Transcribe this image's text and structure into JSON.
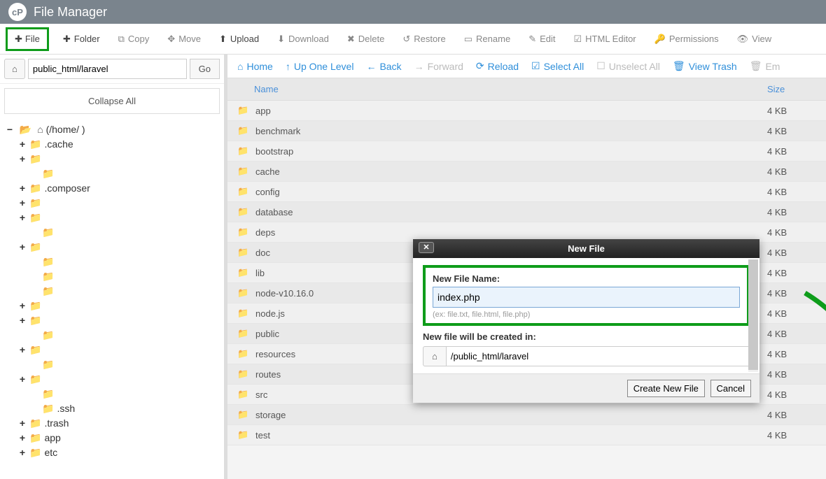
{
  "header": {
    "title": "File Manager"
  },
  "toolbar": {
    "file": "File",
    "folder": "Folder",
    "copy": "Copy",
    "move": "Move",
    "upload": "Upload",
    "download": "Download",
    "delete": "Delete",
    "restore": "Restore",
    "rename": "Rename",
    "edit": "Edit",
    "html_editor": "HTML Editor",
    "permissions": "Permissions",
    "view": "View"
  },
  "path": {
    "value": "public_html/laravel",
    "go": "Go"
  },
  "collapse": "Collapse All",
  "tree": {
    "root": "(/home/         )",
    "items": [
      {
        "exp": "+",
        "label": ".cache",
        "i": 1
      },
      {
        "exp": "+",
        "label": "      ",
        "i": 1
      },
      {
        "exp": "",
        "label": "           ",
        "i": 2
      },
      {
        "exp": "+",
        "label": ".composer",
        "i": 1
      },
      {
        "exp": "+",
        "label": "       ",
        "i": 1
      },
      {
        "exp": "+",
        "label": "        ",
        "i": 1
      },
      {
        "exp": "",
        "label": "        ",
        "i": 2
      },
      {
        "exp": "+",
        "label": "    ",
        "i": 1
      },
      {
        "exp": "",
        "label": "        ",
        "i": 2
      },
      {
        "exp": "",
        "label": "           ",
        "i": 2
      },
      {
        "exp": "",
        "label": "         ",
        "i": 2
      },
      {
        "exp": "+",
        "label": "    ",
        "i": 1
      },
      {
        "exp": "+",
        "label": "    ",
        "i": 1
      },
      {
        "exp": "",
        "label": "   ",
        "i": 2
      },
      {
        "exp": "+",
        "label": "  ",
        "i": 1
      },
      {
        "exp": "",
        "label": "   ",
        "i": 2
      },
      {
        "exp": "+",
        "label": "          ",
        "i": 1
      },
      {
        "exp": "",
        "label": "             ",
        "i": 2
      },
      {
        "exp": "",
        "label": ".ssh",
        "i": 2
      },
      {
        "exp": "+",
        "label": ".trash",
        "i": 1
      },
      {
        "exp": "+",
        "label": "app",
        "i": 1
      },
      {
        "exp": "+",
        "label": "etc",
        "i": 1
      }
    ]
  },
  "actions": {
    "home": "Home",
    "up": "Up One Level",
    "back": "Back",
    "forward": "Forward",
    "reload": "Reload",
    "select_all": "Select All",
    "unselect_all": "Unselect All",
    "view_trash": "View Trash",
    "empty": "Em"
  },
  "table": {
    "name": "Name",
    "size": "Size"
  },
  "files": [
    {
      "name": "app",
      "size": "4 KB"
    },
    {
      "name": "benchmark",
      "size": "4 KB"
    },
    {
      "name": "bootstrap",
      "size": "4 KB"
    },
    {
      "name": "cache",
      "size": "4 KB"
    },
    {
      "name": "config",
      "size": "4 KB"
    },
    {
      "name": "database",
      "size": "4 KB"
    },
    {
      "name": "deps",
      "size": "4 KB"
    },
    {
      "name": "doc",
      "size": "4 KB"
    },
    {
      "name": "lib",
      "size": "4 KB"
    },
    {
      "name": "node-v10.16.0",
      "size": "4 KB"
    },
    {
      "name": "node.js",
      "size": "4 KB"
    },
    {
      "name": "public",
      "size": "4 KB"
    },
    {
      "name": "resources",
      "size": "4 KB"
    },
    {
      "name": "routes",
      "size": "4 KB"
    },
    {
      "name": "src",
      "size": "4 KB"
    },
    {
      "name": "storage",
      "size": "4 KB"
    },
    {
      "name": "test",
      "size": "4 KB"
    }
  ],
  "modal": {
    "title": "New File",
    "name_label": "New File Name:",
    "name_value": "index.php",
    "hint": "(ex: file.txt, file.html, file.php)",
    "created_label": "New file will be created in:",
    "created_path": "/public_html/laravel",
    "create": "Create New File",
    "cancel": "Cancel"
  }
}
